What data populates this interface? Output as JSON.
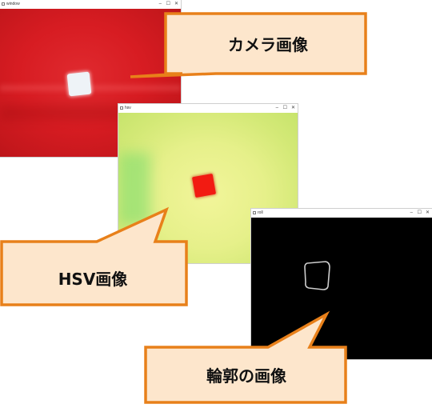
{
  "windows": {
    "camera": {
      "title": "window",
      "controls": [
        "–",
        "☐",
        "✕"
      ]
    },
    "hsv": {
      "title": "hsv",
      "controls": [
        "–",
        "☐",
        "✕"
      ]
    },
    "contour": {
      "title": "roll",
      "controls": [
        "–",
        "☐",
        "✕"
      ]
    }
  },
  "callouts": {
    "camera": "カメラ画像",
    "hsv": "HSV画像",
    "contour": "輪郭の画像"
  },
  "colors": {
    "callout_fill": "#fde6cc",
    "callout_stroke": "#e8801a",
    "camera_bg": "#d71c22",
    "hsv_bg": "#e6f08a",
    "hsv_square": "#f21b12",
    "contour_line": "#cccccc"
  }
}
